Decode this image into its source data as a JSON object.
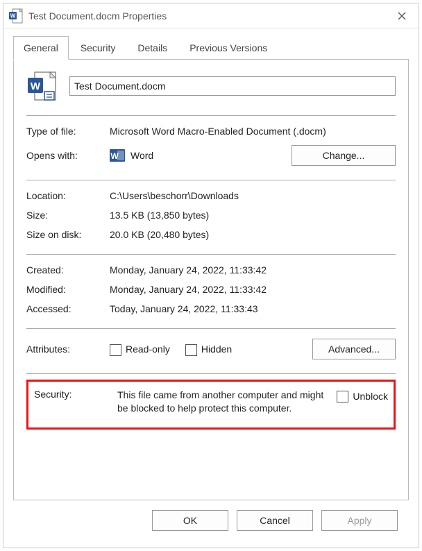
{
  "window": {
    "title": "Test Document.docm Properties"
  },
  "tabs": {
    "general": "General",
    "security": "Security",
    "details": "Details",
    "previous": "Previous Versions"
  },
  "general": {
    "filename": "Test Document.docm",
    "type_label": "Type of file:",
    "type_value": "Microsoft Word Macro-Enabled Document (.docm)",
    "opens_label": "Opens with:",
    "opens_app": "Word",
    "change_btn": "Change...",
    "location_label": "Location:",
    "location_value": "C:\\Users\\beschorr\\Downloads",
    "size_label": "Size:",
    "size_value": "13.5 KB (13,850 bytes)",
    "sizeod_label": "Size on disk:",
    "sizeod_value": "20.0 KB (20,480 bytes)",
    "created_label": "Created:",
    "created_value": "Monday, January 24, 2022, 11:33:42",
    "modified_label": "Modified:",
    "modified_value": "Monday, January 24, 2022, 11:33:42",
    "accessed_label": "Accessed:",
    "accessed_value": "Today, January 24, 2022, 11:33:43",
    "attributes_label": "Attributes:",
    "readonly_label": "Read-only",
    "hidden_label": "Hidden",
    "advanced_btn": "Advanced...",
    "security_label": "Security:",
    "security_text": "This file came from another computer and might be blocked to help protect this computer.",
    "unblock_label": "Unblock"
  },
  "buttons": {
    "ok": "OK",
    "cancel": "Cancel",
    "apply": "Apply"
  }
}
